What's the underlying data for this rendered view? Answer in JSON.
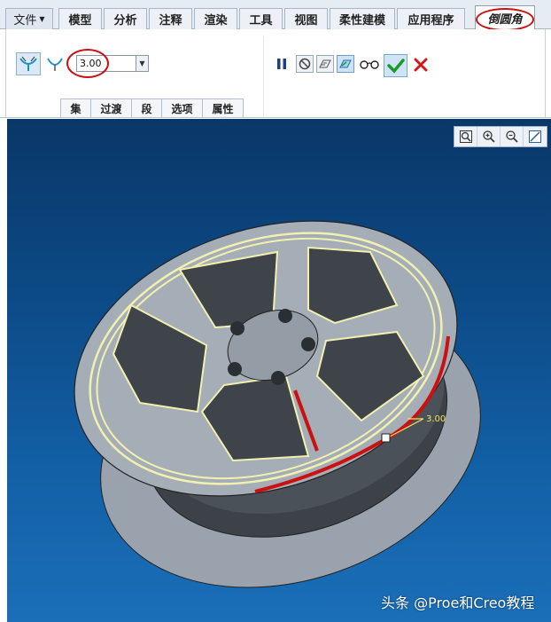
{
  "tabs": [
    {
      "label": "文件",
      "has_dropdown": true
    },
    {
      "label": "模型"
    },
    {
      "label": "分析"
    },
    {
      "label": "注释"
    },
    {
      "label": "渲染"
    },
    {
      "label": "工具"
    },
    {
      "label": "视图"
    },
    {
      "label": "柔性建模"
    },
    {
      "label": "应用程序"
    },
    {
      "label": "倒圆角",
      "active": true
    }
  ],
  "dashboard": {
    "mode_icons": [
      "set-mode-icon",
      "transition-mode-icon"
    ],
    "radius_value": "3.00",
    "panel_tabs": [
      "集",
      "过渡",
      "段",
      "选项",
      "属性"
    ],
    "action_icons": [
      "pause-icon",
      "no-preview-icon",
      "verify-preview-icon",
      "live-preview-icon",
      "glasses-icon",
      "checkmark-icon",
      "cancel-x-icon"
    ]
  },
  "viewport": {
    "view_tools": [
      "refit-icon",
      "zoom-in-icon",
      "zoom-out-icon",
      "repaint-icon"
    ],
    "dimension_label": "3.00",
    "watermark": "头条 @Proe和Creo教程"
  },
  "colors": {
    "highlight_red": "#cc1010",
    "fillet_edge_yellow": "#f2f0b0",
    "background_top": "#0a3768",
    "background_bottom": "#1a6fb8",
    "ok_green": "#1e9a2a",
    "cancel_red": "#d11a1a"
  }
}
